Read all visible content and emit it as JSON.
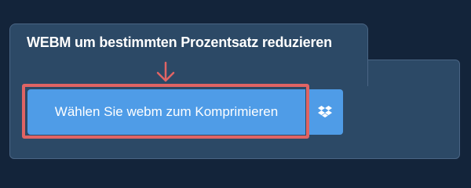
{
  "panel": {
    "title": "WEBM um bestimmten Prozentsatz reduzieren"
  },
  "upload": {
    "choose_button_label": "Wählen Sie webm zum Komprimieren",
    "dropbox_icon": "dropbox-icon"
  },
  "annotation": {
    "arrow_icon": "arrow-down-icon",
    "highlight_color": "#e06464"
  },
  "colors": {
    "background": "#13243a",
    "panel": "#2c4966",
    "button": "#4f9ce7"
  }
}
